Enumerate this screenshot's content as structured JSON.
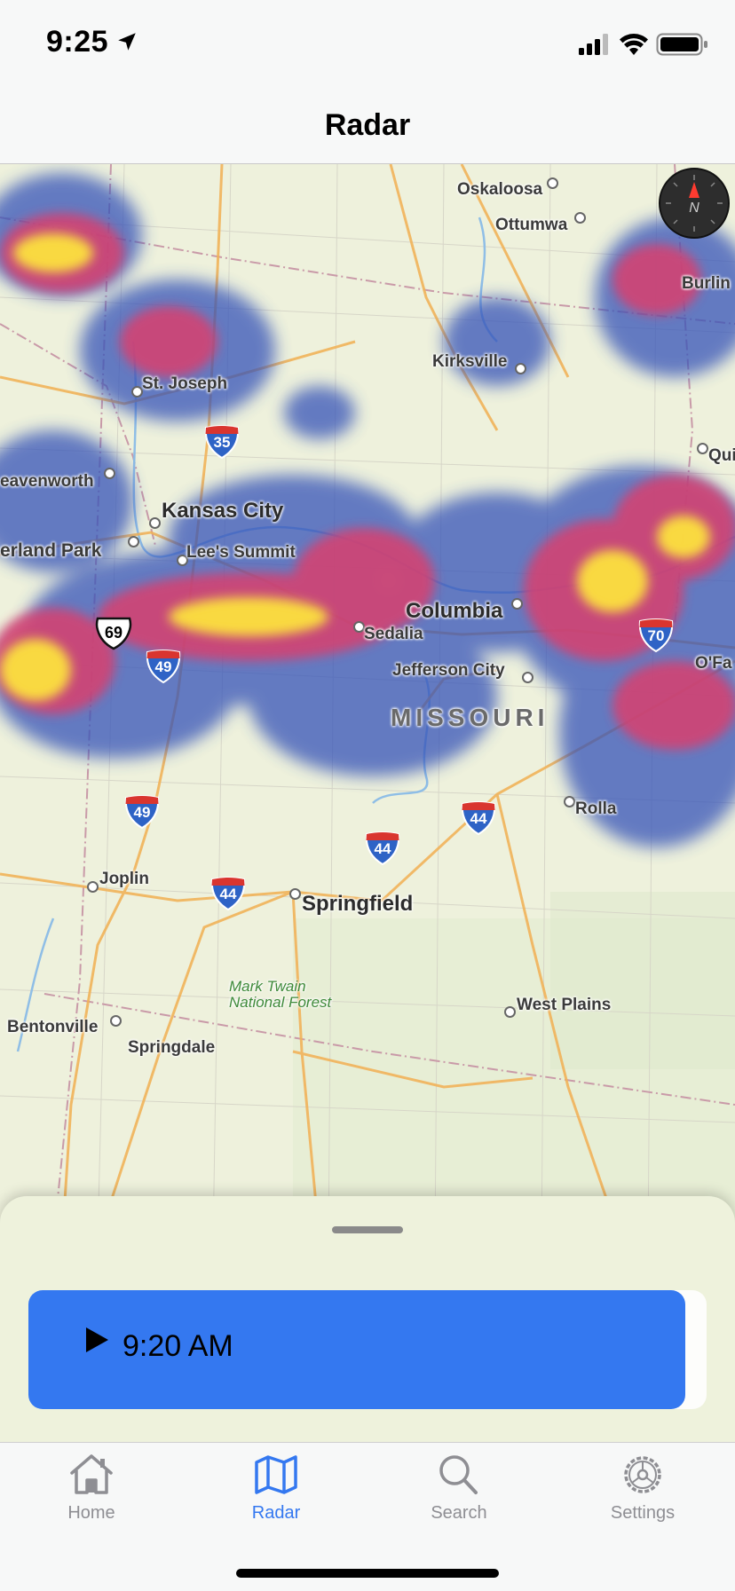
{
  "status_bar": {
    "time": "9:25",
    "icons": [
      "location-arrow-icon",
      "signal-icon",
      "wifi-icon",
      "battery-icon"
    ]
  },
  "header": {
    "title": "Radar"
  },
  "map": {
    "cities_small": [
      "Oskaloosa",
      "Ottumwa",
      "Burlin",
      "Kirksville",
      "St. Joseph",
      "Qui",
      "eavenworth",
      "erland Park",
      "Lee's Summit",
      "Sedalia",
      "Jefferson City",
      "O'Fa",
      "Rolla",
      "Joplin",
      "West Plains",
      "Bentonville",
      "Springdale"
    ],
    "cities_large": [
      "Kansas City",
      "Columbia",
      "Springfield"
    ],
    "state_label": "MISSOURI",
    "forest_label_line1": "Mark Twain",
    "forest_label_line2": "National Forest",
    "interstate_35": "35",
    "interstate_70": "70",
    "interstate_49": "49",
    "interstate_44": "44",
    "us_route_69": "69",
    "compass_letter": "N"
  },
  "player": {
    "time_label": "9:20 AM"
  },
  "tabs": [
    {
      "label": "Home",
      "icon": "house-icon"
    },
    {
      "label": "Radar",
      "icon": "map-icon",
      "active": true
    },
    {
      "label": "Search",
      "icon": "search-icon"
    },
    {
      "label": "Settings",
      "icon": "gear-icon"
    }
  ],
  "colors": {
    "accent": "#3478f0",
    "inactive": "#8e8e93",
    "radar_low": "#3552b8",
    "radar_mid": "#e0456a",
    "radar_high": "#ffe93a"
  }
}
